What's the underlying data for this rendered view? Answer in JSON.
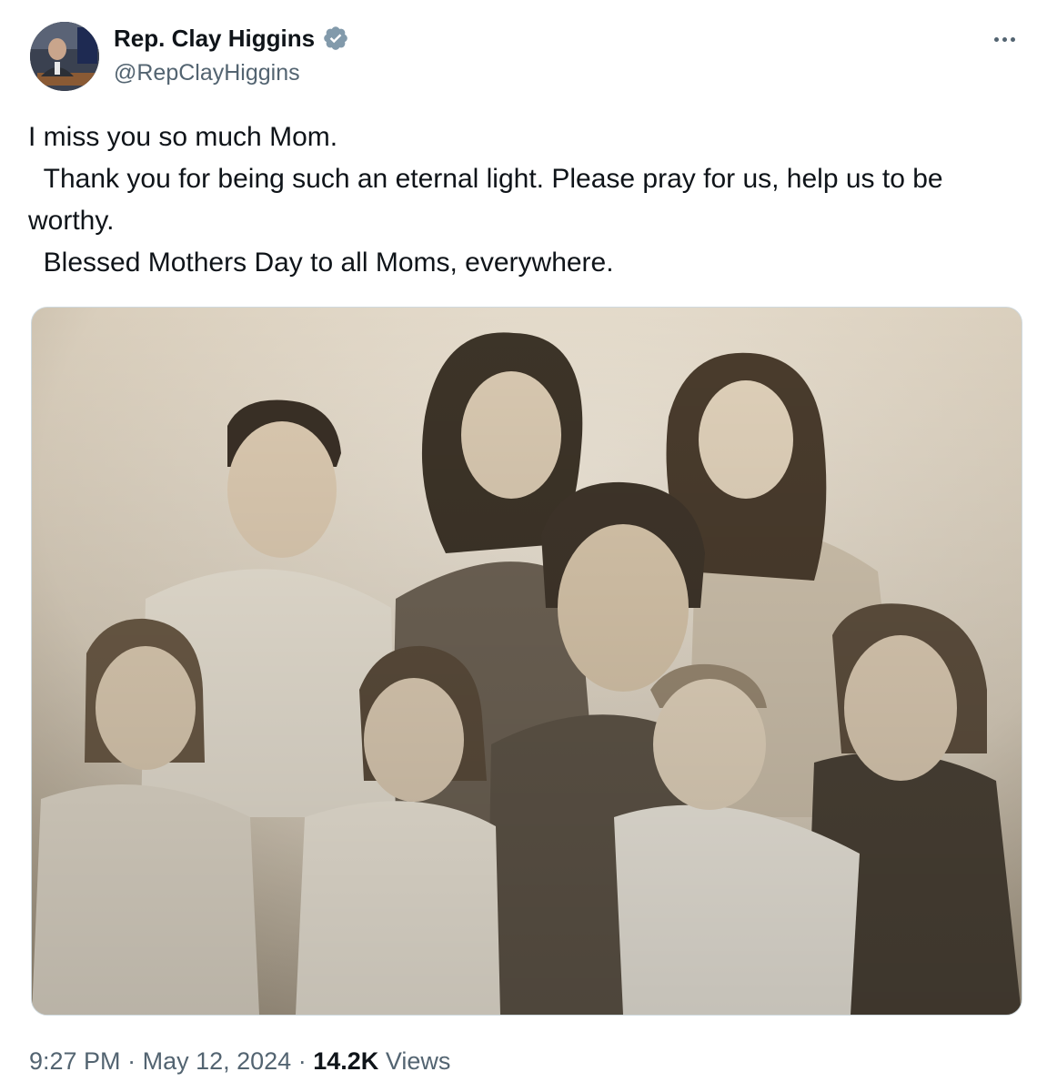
{
  "author": {
    "display_name": "Rep. Clay Higgins",
    "handle": "@RepClayHiggins",
    "verified_color": "#829aab"
  },
  "tweet": {
    "lines": [
      "I miss you so much Mom.",
      "  Thank you for being such an eternal light. Please pray for us, help us to be worthy.",
      "  Blessed Mothers Day to all Moms, everywhere."
    ]
  },
  "media": {
    "type": "photo",
    "style": "sepia family portrait"
  },
  "footer": {
    "time": "9:27 PM",
    "separator": "·",
    "date": "May 12, 2024",
    "views_count": "14.2K",
    "views_label": "Views"
  }
}
